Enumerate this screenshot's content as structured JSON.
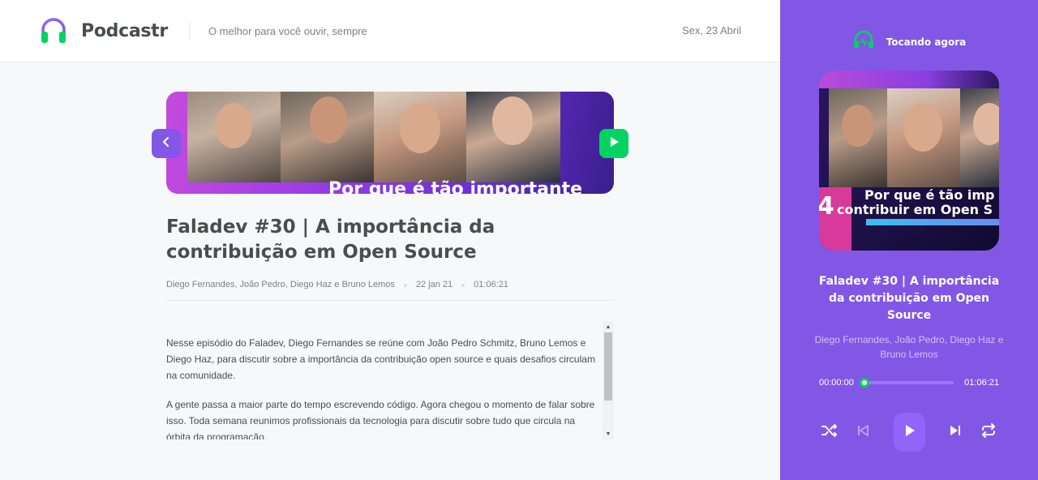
{
  "header": {
    "app_name": "Podcastr",
    "tagline": "O melhor para você ouvir, sempre",
    "date": "Sex, 23 Abril"
  },
  "episode": {
    "thumbnail_caption": "Por que é tão importante",
    "title": "Faladev #30 | A importância da contribuição em Open Source",
    "members": "Diego Fernandes, João Pedro, Diego Haz e Bruno Lemos",
    "published_at": "22 jan 21",
    "duration": "01:06:21",
    "description": [
      "Nesse episódio do Faladev, Diego Fernandes se reúne com João Pedro Schmitz, Bruno Lemos e Diego Haz, para discutir sobre a importância da contribuição open source e quais desafios circulam na comunidade.",
      "A gente passa a maior parte do tempo escrevendo código. Agora chegou o momento de falar sobre isso. Toda semana reunimos profissionais da tecnologia para discutir sobre tudo que circula na órbita da programação."
    ]
  },
  "player": {
    "header_label": "Tocando agora",
    "cover_caption_line1": "Por que é tão imp",
    "cover_caption_line2": "contribuir em Open S",
    "cover_number": "4",
    "title": "Faladev #30 | A importância da contribuição em Open Source",
    "members": "Diego Fernandes, João Pedro, Diego Haz e Bruno Lemos",
    "current_time": "00:00:00",
    "total_time": "01:06:21",
    "progress_fraction": 0.0
  },
  "icons": {
    "logo": "headphones-icon",
    "prev": "chevron-left-icon",
    "play_episode": "play-icon",
    "playing": "headphones-icon",
    "shuffle": "shuffle-icon",
    "previous_track": "skip-previous-icon",
    "play": "play-icon",
    "next_track": "skip-next-icon",
    "repeat": "repeat-icon"
  },
  "colors": {
    "brand_purple": "#8257e5",
    "brand_green": "#04d361",
    "text_dark": "#494d4b",
    "text_muted": "#808080"
  }
}
